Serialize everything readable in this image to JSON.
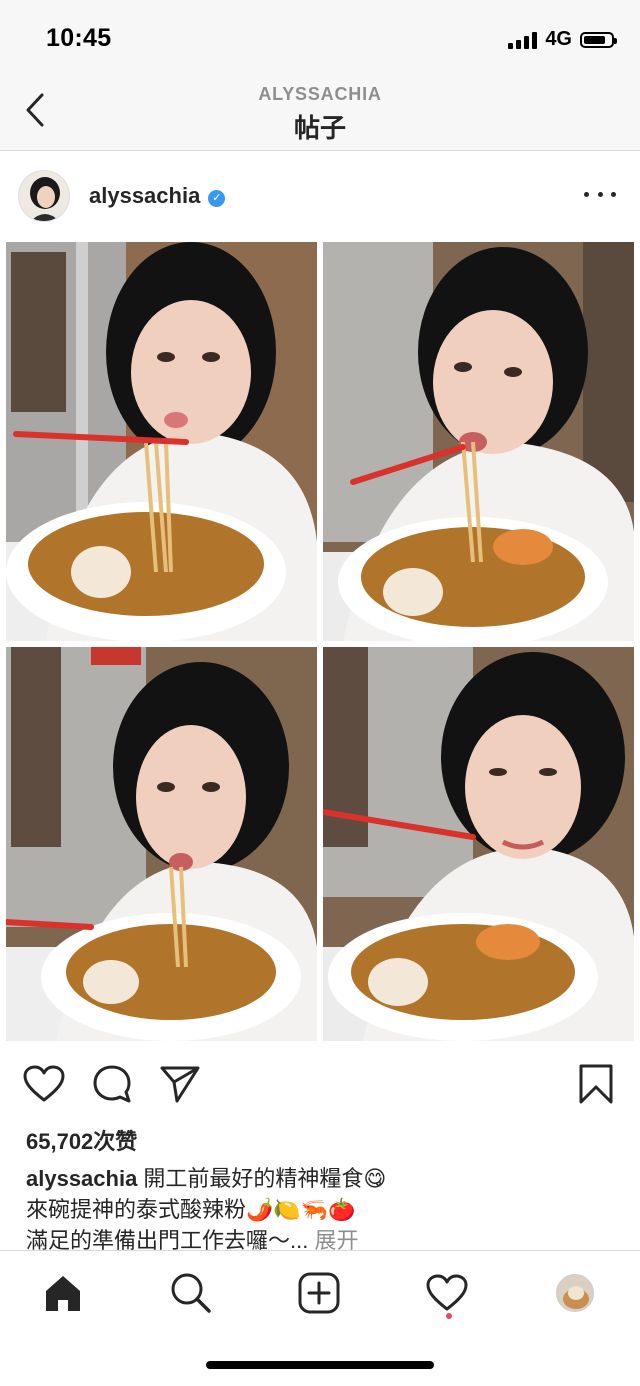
{
  "status_bar": {
    "time": "10:45",
    "network": "4G",
    "battery_level": 0.8
  },
  "nav": {
    "username": "ALYSSACHIA",
    "title": "帖子"
  },
  "post": {
    "username": "alyssachia",
    "verified": true,
    "likes": "65,702次赞",
    "caption_user": "alyssachia",
    "caption_lines": [
      " 開工前最好的精神糧食😋",
      "來碗提神的泰式酸辣粉🌶️🍋🦐🍅",
      "滿足的準備出門工作去囉～..."
    ],
    "more_label": " 展开"
  },
  "icons": {
    "back": "chevron-left-icon",
    "more": "more-options-icon",
    "like": "heart-icon",
    "comment": "comment-bubble-icon",
    "share": "paper-plane-icon",
    "save": "bookmark-icon",
    "tab_home": "home-icon",
    "tab_search": "search-icon",
    "tab_new": "new-post-icon",
    "tab_activity": "heart-icon",
    "tab_profile": "profile-avatar"
  },
  "colors": {
    "accent": "#3897f0",
    "notification": "#ed4956",
    "text": "#262626",
    "muted": "#8e8e8e"
  }
}
